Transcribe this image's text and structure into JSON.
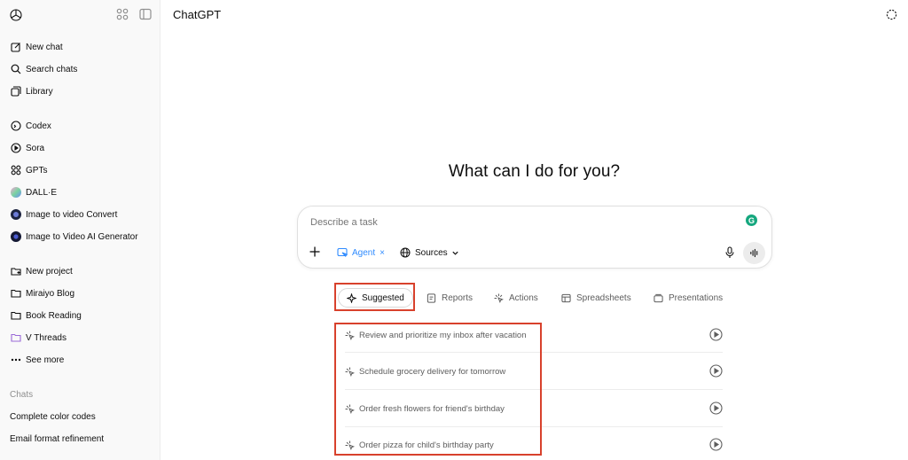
{
  "app": {
    "title": "ChatGPT"
  },
  "sidebar": {
    "primary": [
      {
        "label": "New chat",
        "icon": "edit-icon"
      },
      {
        "label": "Search chats",
        "icon": "search-icon"
      },
      {
        "label": "Library",
        "icon": "library-icon"
      }
    ],
    "apps": [
      {
        "label": "Codex",
        "icon": "codex-icon"
      },
      {
        "label": "Sora",
        "icon": "sora-icon"
      },
      {
        "label": "GPTs",
        "icon": "gpts-icon"
      },
      {
        "label": "DALL·E",
        "icon": "dalle-icon"
      },
      {
        "label": "Image to video Convert",
        "icon": "gpt-avatar-icon"
      },
      {
        "label": "Image to Video AI Generator",
        "icon": "gpt-avatar-icon"
      }
    ],
    "projects": [
      {
        "label": "New project",
        "icon": "new-folder-icon"
      },
      {
        "label": "Miraiyo Blog",
        "icon": "folder-icon"
      },
      {
        "label": "Book Reading",
        "icon": "folder-icon"
      },
      {
        "label": "V Threads",
        "icon": "folder-icon"
      },
      {
        "label": "See more",
        "icon": "more-icon"
      }
    ],
    "chats_label": "Chats",
    "chats": [
      "Complete color codes",
      "Email format refinement"
    ]
  },
  "main": {
    "heading": "What can I do for you?",
    "composer": {
      "placeholder": "Describe a task",
      "agent_label": "Agent",
      "agent_remove": "×",
      "sources_label": "Sources"
    },
    "tabs": [
      {
        "label": "Suggested",
        "icon": "sparkle-icon"
      },
      {
        "label": "Reports",
        "icon": "report-icon"
      },
      {
        "label": "Actions",
        "icon": "actions-icon"
      },
      {
        "label": "Spreadsheets",
        "icon": "spreadsheet-icon"
      },
      {
        "label": "Presentations",
        "icon": "presentation-icon"
      }
    ],
    "suggestions": [
      "Review and prioritize my inbox after vacation",
      "Schedule grocery delivery for tomorrow",
      "Order fresh flowers for friend's birthday",
      "Order pizza for child's birthday party"
    ]
  },
  "colors": {
    "accent": "#2f8bff",
    "highlight": "#d8412c",
    "sidebar_bg": "#f9f9f9"
  }
}
